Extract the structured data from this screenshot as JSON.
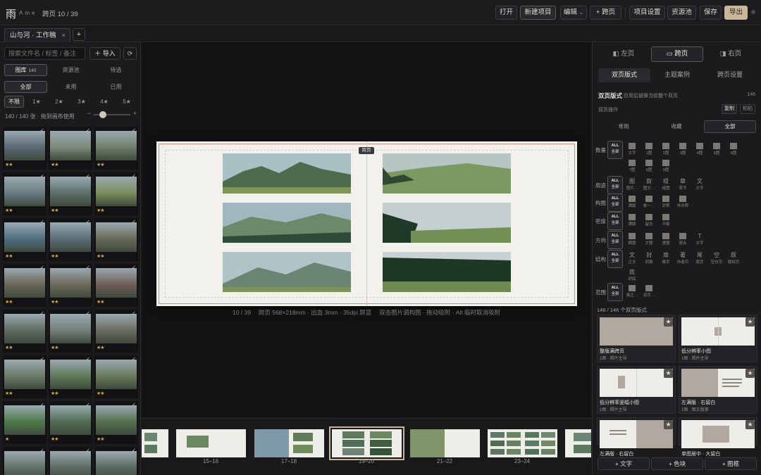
{
  "app": {
    "logo": "雨",
    "logo_sub": "Ame",
    "page_indicator": "跨页 10 / 39"
  },
  "toolbar": {
    "open": "打开",
    "new_project": "新建项目",
    "edit": "编辑",
    "edit_caret": "⌄",
    "add_spread": "+ 跨页",
    "project_settings": "项目设置",
    "resources": "资源池",
    "save": "保存",
    "export": "导出"
  },
  "tabs": {
    "doc": "山与河 · 工作稿",
    "close": "×",
    "add": "+"
  },
  "left": {
    "search_placeholder": "搜索文件名 / 标签 / 备注",
    "import": "＋ 导入",
    "refresh": "⟳",
    "lib_tabs": [
      {
        "label": "图库",
        "count": "140"
      },
      {
        "label": "资源池"
      },
      {
        "label": "待选"
      }
    ],
    "use_tabs": [
      "全部",
      "未用",
      "已用"
    ],
    "star_tabs": [
      "不限",
      "1★",
      "2★",
      "3★",
      "4★",
      "5★"
    ],
    "stat": "140 / 140 张 · 拖到画布使用",
    "slider_minus": "−",
    "slider_plus": "+",
    "zoom_value": 0.25,
    "thumbs": [
      {
        "stars": "★★",
        "c": "#5b6a74"
      },
      {
        "stars": "★★",
        "c": "#7c8a78"
      },
      {
        "stars": "★★",
        "c": "#6f7f6a"
      },
      {
        "stars": "★★",
        "c": "#6a7c84"
      },
      {
        "stars": "★★",
        "c": "#5d6f6a"
      },
      {
        "stars": "★★",
        "c": "#7a8d5c"
      },
      {
        "stars": "★★",
        "c": "#4f6f82"
      },
      {
        "stars": "★★",
        "c": "#5c6c78"
      },
      {
        "stars": "★★",
        "c": "#6b6a58"
      },
      {
        "stars": "★★",
        "c": "#6c6656"
      },
      {
        "stars": "★★",
        "c": "#706a5a"
      },
      {
        "stars": "★★",
        "c": "#6f5f58"
      },
      {
        "stars": "★★",
        "c": "#5f6b60"
      },
      {
        "stars": "★★",
        "c": "#74807a"
      },
      {
        "stars": "★★",
        "c": "#6a6c60"
      },
      {
        "stars": "★★",
        "c": "#6c7c6a"
      },
      {
        "stars": "★★",
        "c": "#5f7a5a"
      },
      {
        "stars": "★★",
        "c": "#6a7a5e"
      },
      {
        "stars": "★",
        "c": "#4e7a4a"
      },
      {
        "stars": "★★",
        "c": "#4f6e52"
      },
      {
        "stars": "★★",
        "c": "#55704f"
      },
      {
        "stars": "",
        "c": "#63736a"
      },
      {
        "stars": "",
        "c": "#5c6b62"
      },
      {
        "stars": "",
        "c": "#5a6a5e"
      }
    ]
  },
  "canvas": {
    "gutter_tag": "跨页",
    "caption": "10 / 39　 跨页 568×218mm · 出血 3mm · 35dpi 屏显　 双击图片调构图 · 拖动吸附 · Alt 临时取消吸附",
    "photos": [
      "#6d8a6a",
      "#7d9470",
      "#5f7d6a",
      "#4f6f55",
      "#7a9184",
      "#4a6a4a"
    ]
  },
  "film": [
    {
      "label": ""
    },
    {
      "label": "15–16"
    },
    {
      "label": "17–18"
    },
    {
      "label": "19–20"
    },
    {
      "label": "21–22"
    },
    {
      "label": "23–24"
    },
    {
      "label": ""
    }
  ],
  "right": {
    "tabs": [
      "左页",
      "跨页",
      "右页"
    ],
    "tab_icons": [
      "◧",
      "▭",
      "◨"
    ],
    "subtabs": [
      "双页版式",
      "主题案例",
      "跨页设置"
    ],
    "head": "双页版式",
    "head_sub": "应用后替换当前整个双页",
    "head_count": "146",
    "ops_label": "双页操作",
    "copy": "复制",
    "paste": "粘贴",
    "filters": [
      "常用",
      "收藏",
      "全部"
    ],
    "rows": {
      "count": {
        "label": "数量",
        "opts": [
          "全部",
          "文字",
          "1图",
          "2图",
          "3图",
          "4图",
          "5图",
          "6图",
          "7图",
          "8图",
          "9图"
        ]
      },
      "use": {
        "label": "用途",
        "opts": [
          "全部",
          "图片…",
          "图文…",
          "组图",
          "章节",
          "文字"
        ],
        "glyphs": [
          "",
          "图",
          "叙",
          "组",
          "章",
          "文"
        ]
      },
      "comp": {
        "label": "构图",
        "opts": [
          "全部",
          "满版",
          "单一…",
          "对称",
          "非对称"
        ]
      },
      "density": {
        "label": "密度",
        "opts": [
          "全部",
          "满版",
          "留白",
          "平衡"
        ]
      },
      "dir": {
        "label": "方向",
        "opts": [
          "全部",
          "横图",
          "方图",
          "竖图",
          "混合",
          "文字"
        ],
        "glyphs": [
          "",
          "",
          "",
          "",
          "",
          "T"
        ]
      },
      "struct": {
        "label": "结构",
        "opts": [
          "全部",
          "正文",
          "封面",
          "扉页",
          "作者页",
          "尾页",
          "空白页",
          "版权页",
          "封底"
        ],
        "glyphs": [
          "",
          "文",
          "封",
          "扉",
          "著",
          "尾",
          "空",
          "版",
          "底"
        ]
      },
      "range": {
        "label": "范围",
        "opts": [
          "全部",
          "真正…",
          "双页…"
        ]
      }
    },
    "all_tag": "ALL",
    "result": "146 / 146 个双页版式",
    "cards": [
      {
        "title": "整版满跨页",
        "sub": "1图 · 照片主导"
      },
      {
        "title": "低分辨率小图",
        "sub": "1图 · 照片主导"
      },
      {
        "title": "低分辨率竖幅小图",
        "sub": "1图 · 照片主导"
      },
      {
        "title": "左满版 · 右留白",
        "sub": "1图 · 图文叙事"
      },
      {
        "title": "左满版 · 右留白",
        "sub": ""
      },
      {
        "title": "单图居中 · 大留白",
        "sub": ""
      }
    ],
    "star": "★",
    "add_text": "+ 文字",
    "add_block": "+ 色块",
    "add_frame": "+ 图框"
  }
}
